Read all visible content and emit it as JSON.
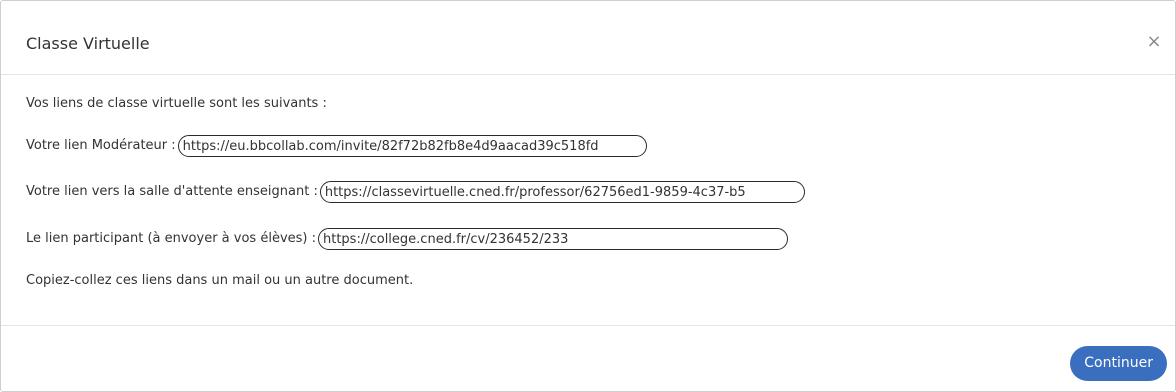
{
  "dialog": {
    "title": "Classe Virtuelle",
    "close_symbol": "×"
  },
  "body": {
    "intro": "Vos liens de classe virtuelle sont les suivants :",
    "moderator": {
      "label": "Votre lien Modérateur :",
      "value": "https://eu.bbcollab.com/invite/82f72b82fb8e4d9aacad39c518fd"
    },
    "waiting_room": {
      "label": "Votre lien vers la salle d'attente enseignant :",
      "value": "https://classevirtuelle.cned.fr/professor/62756ed1-9859-4c37-b5"
    },
    "participant": {
      "label": "Le lien participant (à envoyer à vos élèves) :",
      "value": "https://college.cned.fr/cv/236452/233"
    },
    "footer_note": "Copiez-collez ces liens dans un mail ou un autre document."
  },
  "footer": {
    "continue_label": "Continuer"
  },
  "colors": {
    "primary_button": "#3a6ebf",
    "divider": "#e5e5e5"
  }
}
